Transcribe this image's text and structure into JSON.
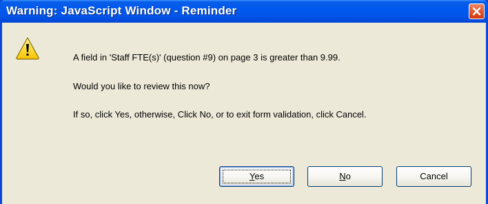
{
  "window": {
    "title": "Warning: JavaScript Window - Reminder"
  },
  "icons": {
    "close": "close-icon",
    "warning": "warning-icon"
  },
  "message": {
    "line1": "A field in 'Staff FTE(s)' (question #9) on page 3 is greater than 9.99.",
    "line2": "Would you like to review this now?",
    "line3": "If so, click Yes, otherwise, Click No, or to exit form validation, click Cancel."
  },
  "buttons": {
    "yes_mnemonic": "Y",
    "yes_rest": "es",
    "no_mnemonic": "N",
    "no_rest": "o",
    "cancel": "Cancel"
  },
  "colors": {
    "titlebar": "#0058ee",
    "dialog_face": "#ece9d8",
    "close_button": "#e35a2f",
    "warning_yellow": "#ffd800"
  }
}
